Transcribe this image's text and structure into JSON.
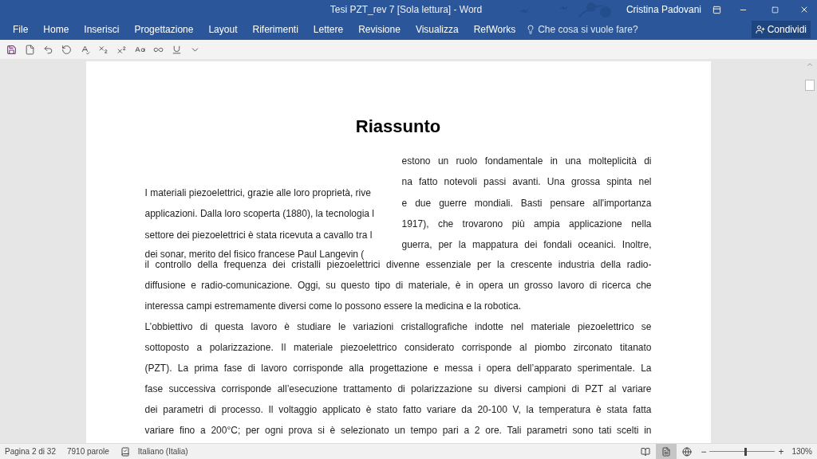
{
  "window": {
    "title": "Tesi PZT_rev 7 [Sola lettura] - Word",
    "user": "Cristina Padovani"
  },
  "ribbon": {
    "tabs": [
      {
        "label": "File",
        "selected": false
      },
      {
        "label": "Home",
        "selected": false
      },
      {
        "label": "Inserisci",
        "selected": false
      },
      {
        "label": "Progettazione",
        "selected": false
      },
      {
        "label": "Layout",
        "selected": false
      },
      {
        "label": "Riferimenti",
        "selected": false
      },
      {
        "label": "Lettere",
        "selected": false
      },
      {
        "label": "Revisione",
        "selected": false
      },
      {
        "label": "Visualizza",
        "selected": false
      },
      {
        "label": "RefWorks",
        "selected": false
      }
    ],
    "tell_me": {
      "placeholder": "Che cosa si vuole fare?"
    },
    "share_button": "Condividi"
  },
  "document": {
    "title": "Riassunto",
    "fragment_right": [
      "estono un ruolo fondamentale in una molteplicità di",
      "na fatto notevoli passi avanti. Una grossa spinta nel",
      "e due guerre mondiali. Basti pensare all'importanza",
      "1917), che trovarono più ampia applicazione nella",
      "guerra, per la mappatura dei fondali oceanici. Inoltre,"
    ],
    "fragment_left": [
      "I materiali piezoelettrici, grazie alle loro proprietà, rive",
      "applicazioni. Dalla loro scoperta (1880), la tecnologia l",
      "settore dei piezoelettrici è stata ricevuta a cavallo tra l",
      "dei sonar, merito del fisico francese Paul Langevin ("
    ],
    "lines": [
      {
        "text": "il controllo della frequenza dei cristalli piezoelettrici divenne essenziale per la crescente industria della radio-",
        "justify": true
      },
      {
        "text": "diffusione e radio-comunicazione. Oggi, su questo tipo di materiale, è in opera un grosso lavoro di ricerca che",
        "justify": true
      },
      {
        "text": "interessa campi estremamente diversi come lo possono essere la medicina e la robotica.",
        "justify": false
      },
      {
        "text": "L’obbiettivo di questa lavoro è studiare le variazioni cristallografiche indotte nel materiale piezoelettrico se",
        "justify": true
      },
      {
        "text": "sottoposto a polarizzazione. Il materiale piezoelettrico considerato corrisponde al piombo zirconato titanato",
        "justify": true
      },
      {
        "text": "(PZT). La prima fase di lavoro corrisponde alla progettazione e messa i opera dell’apparato sperimentale. La",
        "justify": true
      },
      {
        "text": "fase successiva corrisponde all’esecuzione trattamento di polarizzazione su diversi campioni di PZT al variare",
        "justify": true
      },
      {
        "text": "dei parametri di processo. Il voltaggio applicato è stato fatto variare da 20-100 V, la temperatura è stata fatta",
        "justify": true
      },
      {
        "text": "variare fino a 200°C; per ogni prova si è selezionato un tempo pari a 2 ore. Tali parametri sono tati scelti in",
        "justify": true
      }
    ]
  },
  "status_bar": {
    "page": "Pagina 2 di 32",
    "words": "7910 parole",
    "language": "Italiano (Italia)",
    "views": [
      {
        "kind": "read",
        "selected": false
      },
      {
        "kind": "print",
        "selected": true
      },
      {
        "kind": "web",
        "selected": false
      }
    ],
    "zoom_minus": "−",
    "zoom_plus": "+",
    "zoom": {
      "level": 0.53
    },
    "zoom_reading": "130%"
  }
}
